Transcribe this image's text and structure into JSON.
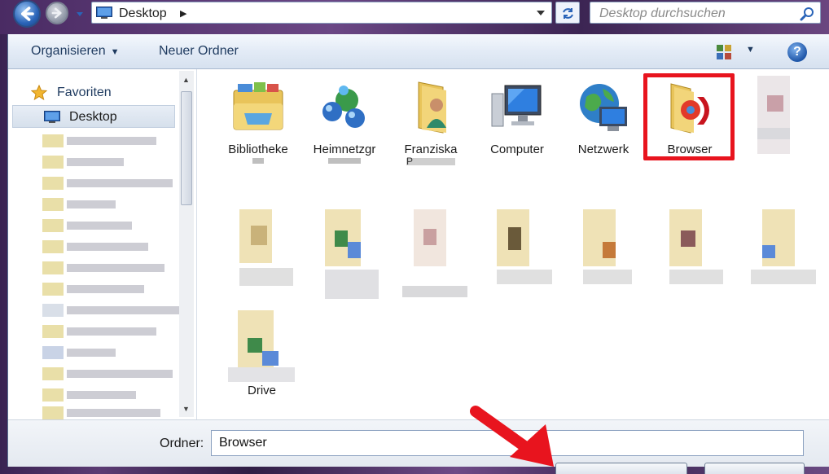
{
  "address": {
    "location": "Desktop",
    "search_placeholder": "Desktop durchsuchen"
  },
  "toolbar": {
    "organize_label": "Organisieren",
    "new_folder_label": "Neuer Ordner"
  },
  "nav": {
    "favorites_label": "Favoriten",
    "selected_item_label": "Desktop"
  },
  "items": [
    {
      "label": "Bibliotheke",
      "icon": "libraries-icon"
    },
    {
      "label": "Heimnetzgr",
      "icon": "homegroup-icon"
    },
    {
      "label": "Franziska",
      "icon": "user-folder-icon"
    },
    {
      "label": "Computer",
      "icon": "computer-icon"
    },
    {
      "label": "Netzwerk",
      "icon": "network-icon"
    },
    {
      "label": "Browser",
      "icon": "browser-folder-icon"
    }
  ],
  "partial_labels": {
    "row1_user_folder_fragment": "P",
    "drive_item": "Drive"
  },
  "footer": {
    "filename_label": "Ordner:",
    "filename_value": "Browser"
  },
  "colors": {
    "highlight": "#e8141e",
    "accent": "#1f56a8"
  }
}
